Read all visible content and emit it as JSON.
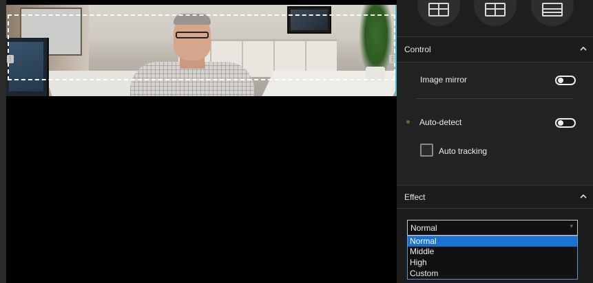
{
  "video": {
    "title": "camera-preview"
  },
  "layouts": [
    {
      "icon": "layout-split-icon"
    },
    {
      "icon": "layout-split-icon"
    },
    {
      "icon": "layout-grid-icon"
    }
  ],
  "control": {
    "header": "Control",
    "image_mirror_label": "Image mirror",
    "image_mirror_on": false,
    "auto_detect_label": "Auto-detect",
    "auto_detect_on": false,
    "auto_tracking_label": "Auto tracking",
    "auto_tracking_checked": false
  },
  "effect": {
    "header": "Effect",
    "selected": "Normal",
    "options": [
      "Normal",
      "Middle",
      "High",
      "Custom"
    ],
    "highlighted_index": 0
  },
  "colors": {
    "panel_bg": "#1c1c1c",
    "accent_select": "#1a73d1",
    "frame_edge": "#4db8d8"
  }
}
